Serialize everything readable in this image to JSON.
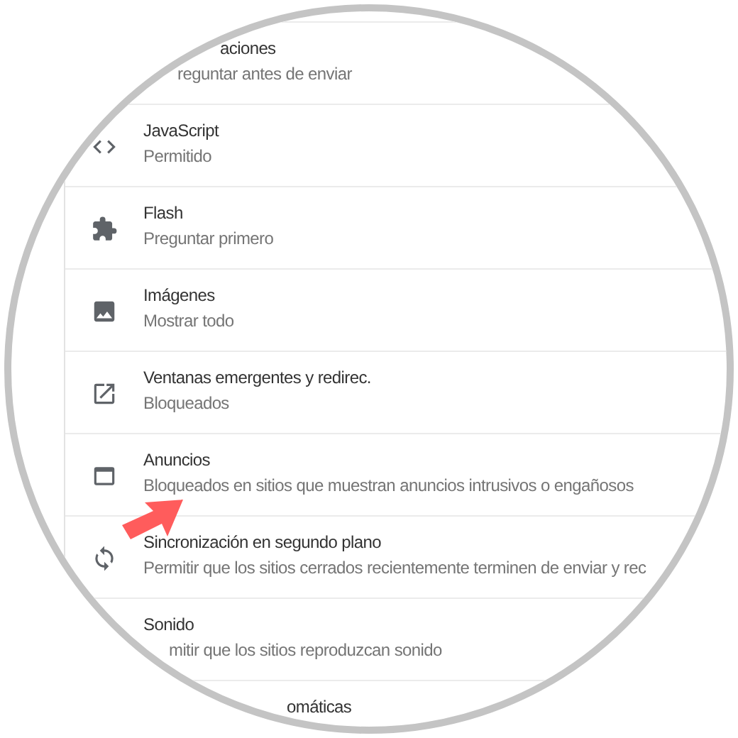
{
  "settings": [
    {
      "title": "aciones",
      "subtitle": "reguntar antes de enviar"
    },
    {
      "title": "JavaScript",
      "subtitle": "Permitido"
    },
    {
      "title": "Flash",
      "subtitle": "Preguntar primero"
    },
    {
      "title": "Imágenes",
      "subtitle": "Mostrar todo"
    },
    {
      "title": "Ventanas emergentes y redirec.",
      "subtitle": "Bloqueados"
    },
    {
      "title": "Anuncios",
      "subtitle": "Bloqueados en sitios que muestran anuncios intrusivos o engañosos"
    },
    {
      "title": "Sincronización en segundo plano",
      "subtitle": "Permitir que los sitios cerrados recientemente terminen de enviar y rec"
    },
    {
      "title": "Sonido",
      "subtitle": "mitir que los sitios reproduzcan sonido"
    },
    {
      "title": "omáticas"
    }
  ]
}
